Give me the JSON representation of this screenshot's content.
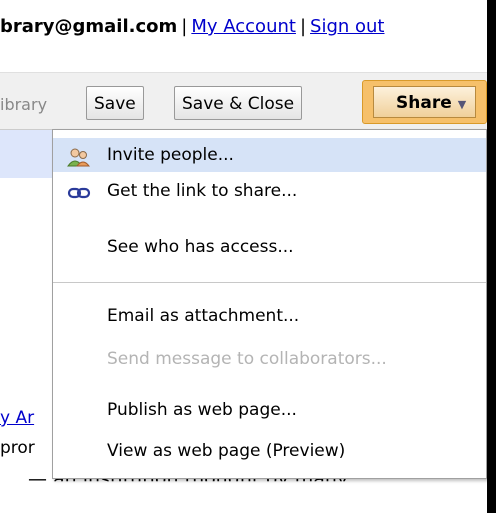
{
  "topbar": {
    "email": "brary@gmail.com",
    "separator": "|",
    "my_account": "My Account",
    "sign_out": "Sign out"
  },
  "toolbar": {
    "breadcrumb": "ibrary",
    "save": "Save",
    "save_close": "Save & Close",
    "share": "Share"
  },
  "share_menu": {
    "items": [
      {
        "label": "Invite people...",
        "icon": "people-icon"
      },
      {
        "label": "Get the link to share...",
        "icon": "link-icon"
      },
      {
        "label": "See who has access..."
      },
      {
        "label": "Email as attachment..."
      },
      {
        "label": "Send message to collaborators..."
      },
      {
        "label": "Publish as web page..."
      },
      {
        "label": "View as web page (Preview)"
      }
    ]
  },
  "document": {
    "link_fragment": "y Ar",
    "text_fragment": "pror",
    "body_fragment": "— an institution thought by many"
  }
}
